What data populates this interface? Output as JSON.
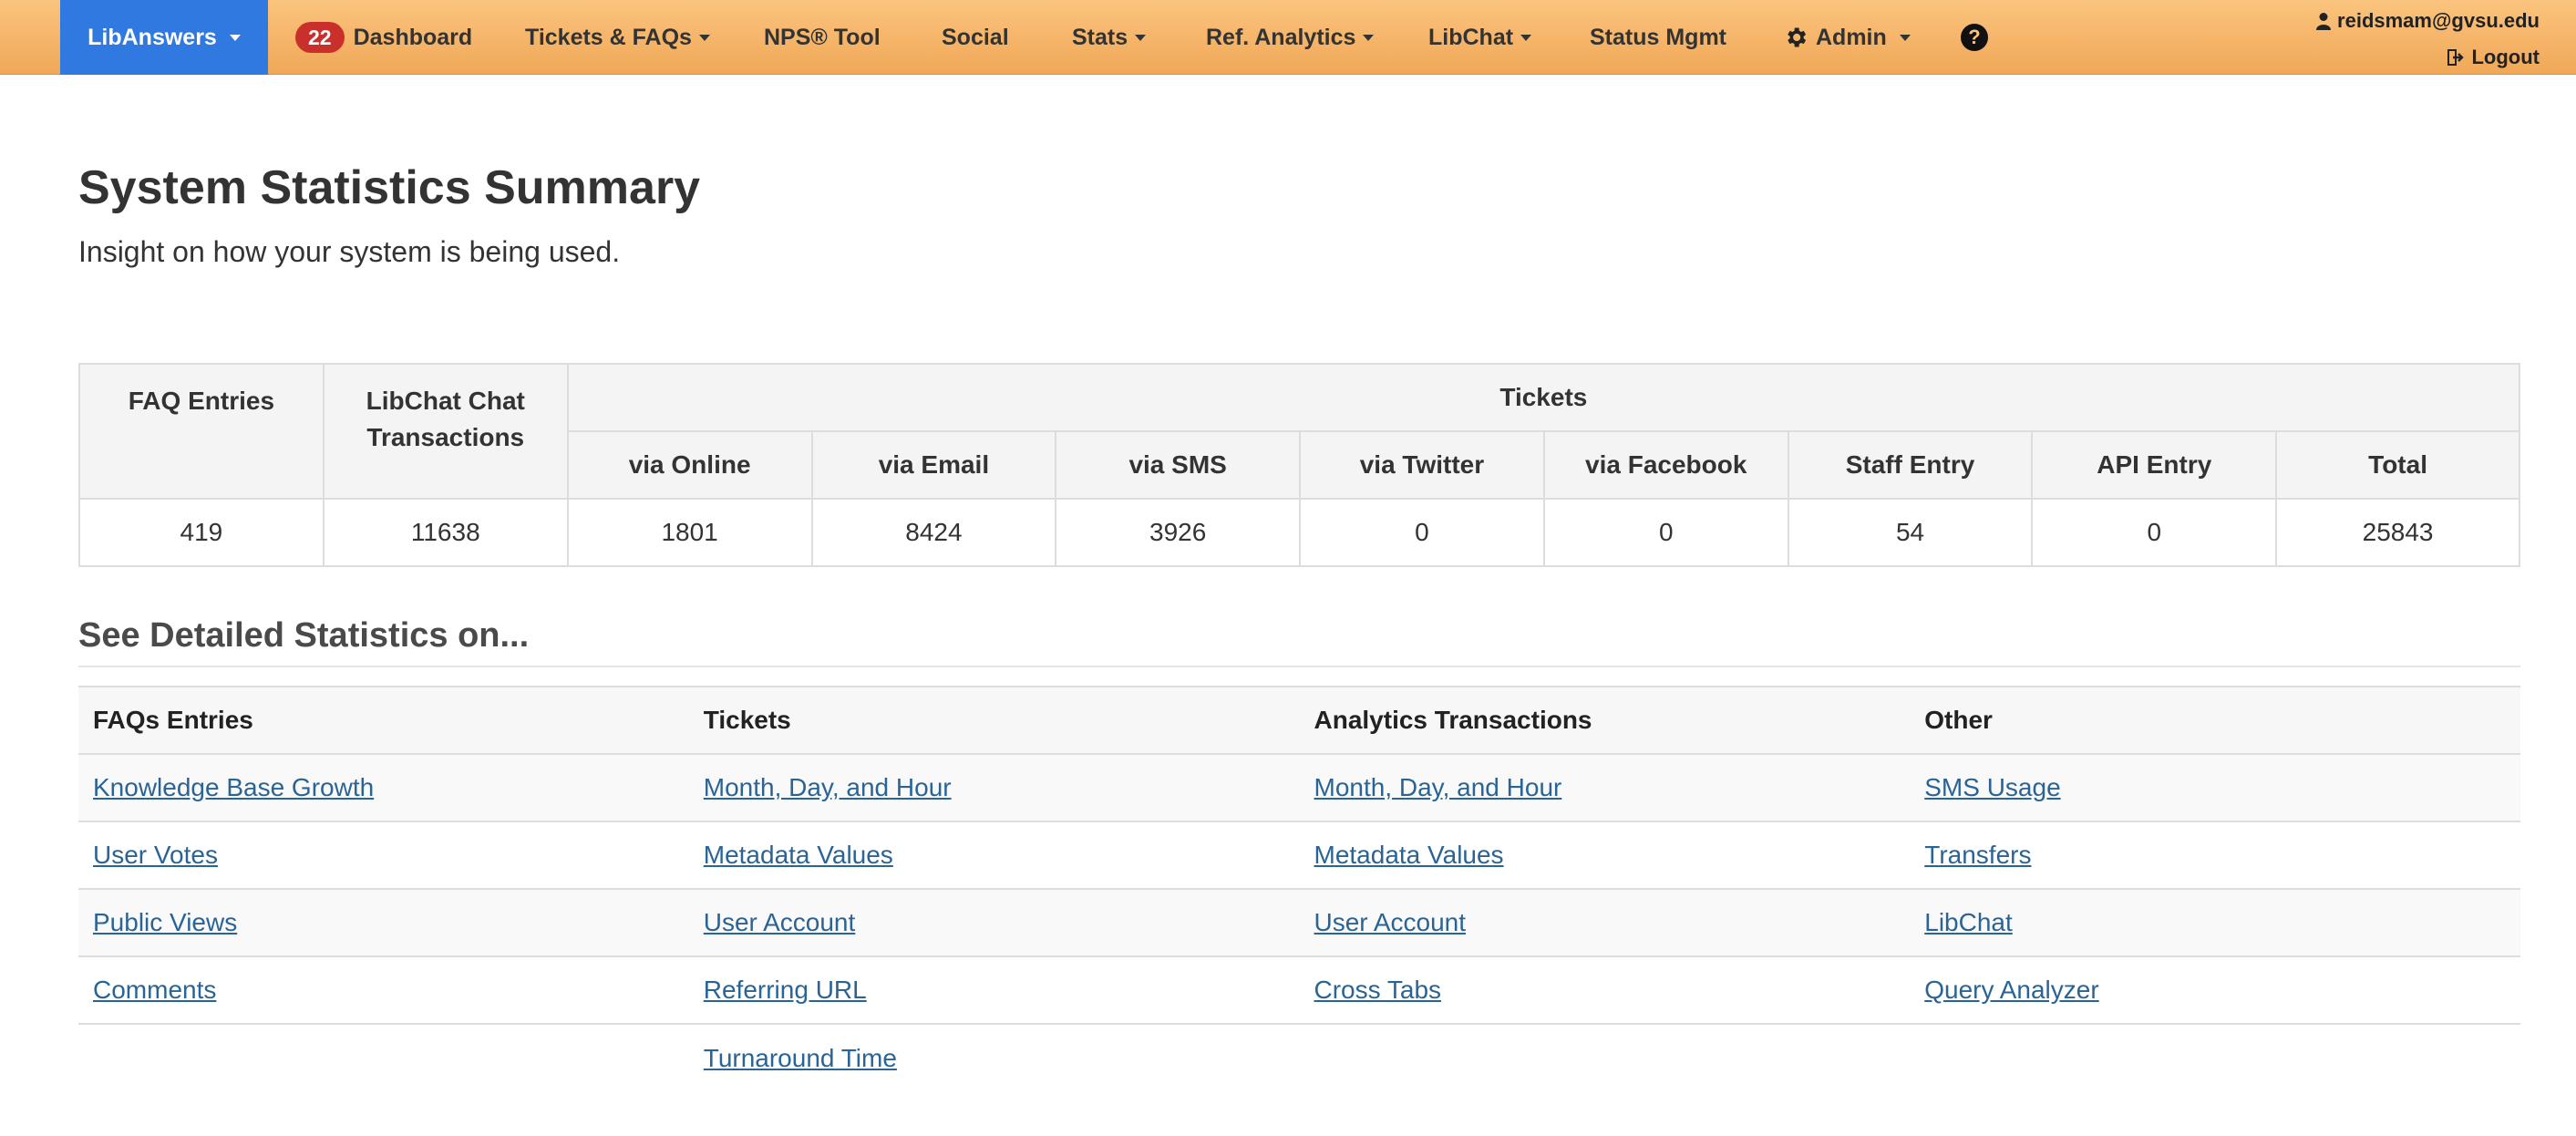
{
  "nav": {
    "brand": "LibAnswers",
    "dashboard_badge": "22",
    "dashboard": "Dashboard",
    "tickets_faqs": "Tickets & FAQs",
    "nps": "NPS® Tool",
    "social": "Social",
    "stats": "Stats",
    "ref_analytics": "Ref. Analytics",
    "libchat": "LibChat",
    "status_mgmt": "Status Mgmt",
    "admin": "Admin",
    "help_icon": "?",
    "user_email": "reidsmam@gvsu.edu",
    "logout": "Logout",
    "accent_color": "#3079e0",
    "bar_color": "#f0a858"
  },
  "page": {
    "title": "System Statistics Summary",
    "subtitle": "Insight on how your system is being used."
  },
  "summary": {
    "headers": {
      "faq_entries": "FAQ Entries",
      "libchat_transactions": "LibChat Chat Transactions",
      "tickets": "Tickets",
      "ticket_columns": [
        "via Online",
        "via Email",
        "via SMS",
        "via Twitter",
        "via Facebook",
        "Staff Entry",
        "API Entry",
        "Total"
      ]
    },
    "values": [
      "419",
      "11638",
      "1801",
      "8424",
      "3926",
      "0",
      "0",
      "54",
      "0",
      "25843"
    ]
  },
  "detailed": {
    "heading": "See Detailed Statistics on...",
    "columns": [
      "FAQs Entries",
      "Tickets",
      "Analytics Transactions",
      "Other"
    ],
    "rows": [
      [
        "Knowledge Base Growth",
        "Month, Day, and Hour",
        "Month, Day, and Hour",
        "SMS Usage"
      ],
      [
        "User Votes",
        "Metadata Values",
        "Metadata Values",
        "Transfers"
      ],
      [
        "Public Views",
        "User Account",
        "User Account",
        "LibChat"
      ],
      [
        "Comments",
        "Referring URL",
        "Cross Tabs",
        "Query Analyzer"
      ],
      [
        "",
        "Turnaround Time",
        "",
        ""
      ]
    ]
  }
}
